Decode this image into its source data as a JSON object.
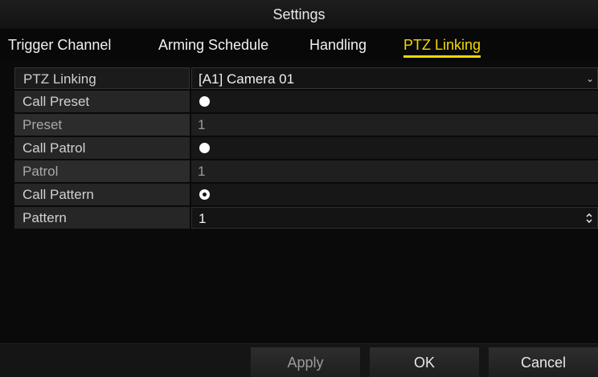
{
  "window": {
    "title": "Settings"
  },
  "tabs": [
    {
      "label": "Trigger Channel",
      "active": false
    },
    {
      "label": "Arming Schedule",
      "active": false
    },
    {
      "label": "Handling",
      "active": false
    },
    {
      "label": "PTZ Linking",
      "active": true
    }
  ],
  "ptz_linking": {
    "label": "PTZ Linking",
    "selected_camera": "[A1] Camera 01",
    "dropdown_icon": "chevron-down-icon"
  },
  "rows": [
    {
      "label": "Call Preset",
      "control": "radio",
      "checked": false
    },
    {
      "label": "Preset",
      "value": "1",
      "enabled": false
    },
    {
      "label": "Call Patrol",
      "control": "radio",
      "checked": false
    },
    {
      "label": "Patrol",
      "value": "1",
      "enabled": false
    },
    {
      "label": "Call Pattern",
      "control": "radio",
      "checked": true
    },
    {
      "label": "Pattern",
      "value": "1",
      "enabled": true,
      "control": "spinner"
    }
  ],
  "buttons": {
    "apply": "Apply",
    "ok": "OK",
    "cancel": "Cancel"
  },
  "colors": {
    "accent": "#f5d800",
    "background": "#0a0a0a",
    "text": "#f0f0f0"
  }
}
